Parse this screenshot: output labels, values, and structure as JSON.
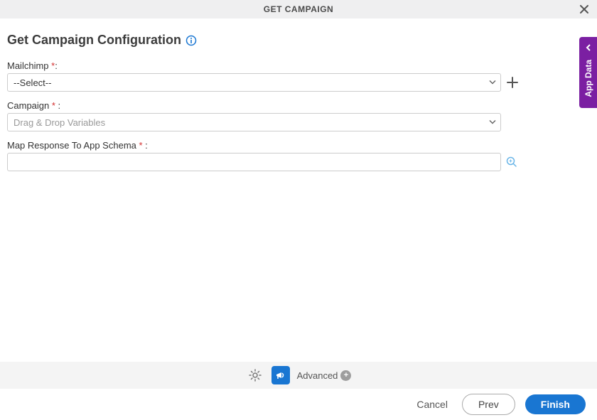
{
  "header": {
    "title": "GET CAMPAIGN"
  },
  "section": {
    "title": "Get Campaign Configuration"
  },
  "fields": {
    "mailchimp": {
      "label": "Mailchimp ",
      "required": "*",
      "colon": ":",
      "value": "--Select--"
    },
    "campaign": {
      "label": "Campaign  ",
      "required": "*",
      "colon": " :",
      "placeholder": "Drag & Drop Variables"
    },
    "mapResponse": {
      "label": "Map Response To App Schema  ",
      "required": "*",
      "colon": " :"
    }
  },
  "sideTab": {
    "label": "App Data"
  },
  "toolbar": {
    "advanced": "Advanced"
  },
  "footer": {
    "cancel": "Cancel",
    "prev": "Prev",
    "finish": "Finish"
  }
}
